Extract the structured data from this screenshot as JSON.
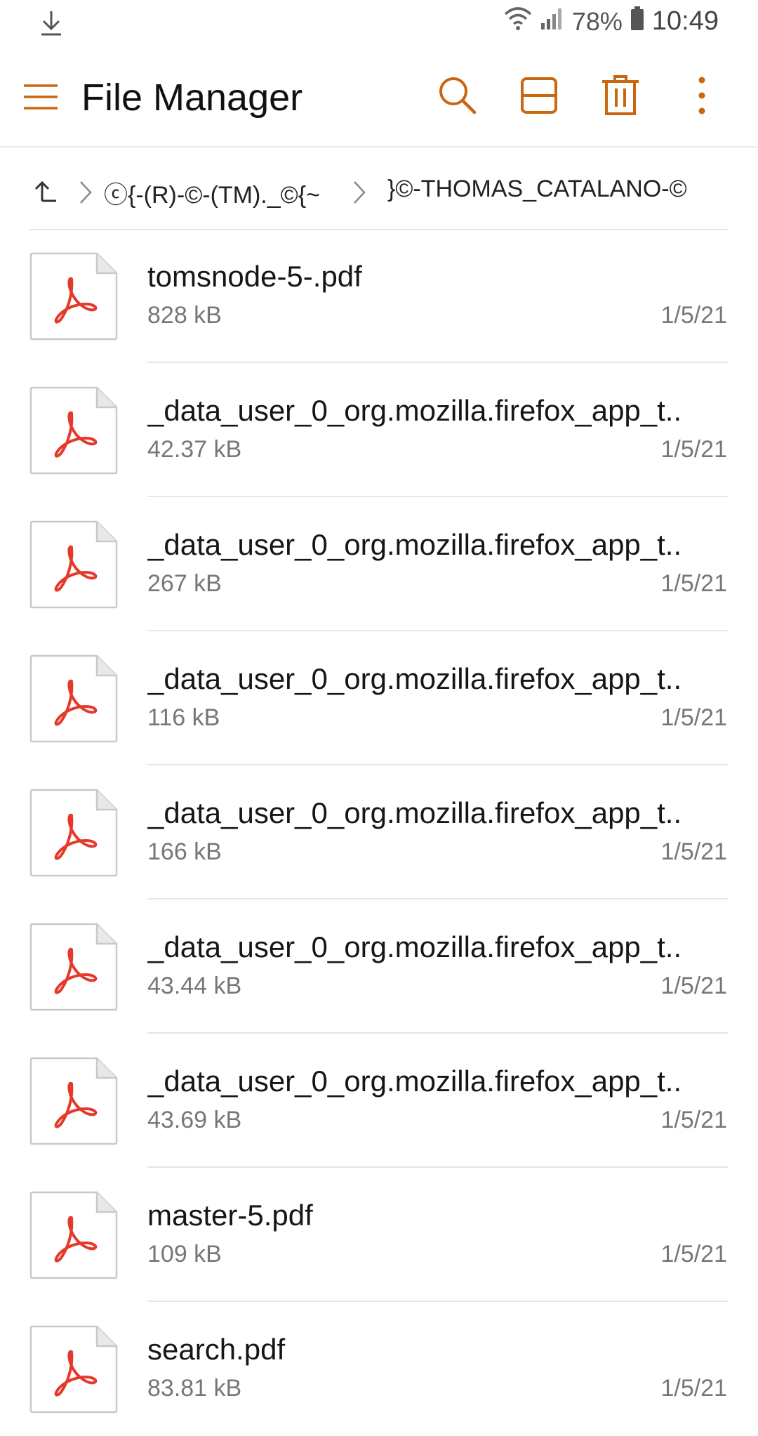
{
  "status_bar": {
    "battery_percent": "78%",
    "time": "10:49",
    "icons": [
      "download-icon",
      "wifi-icon",
      "signal-icon",
      "battery-icon"
    ]
  },
  "app_bar": {
    "title": "File Manager",
    "accent_color": "#c8670f",
    "actions": [
      "search-icon",
      "view-toggle-icon",
      "trash-icon",
      "more-vert-icon"
    ]
  },
  "breadcrumb": {
    "segments": [
      "ⓒ{-(R)-©-(TM)._©{~",
      "}©-THOMAS_CATALANO-©"
    ]
  },
  "files": [
    {
      "name": "tomsnode-5-.pdf",
      "size": "828 kB",
      "date": "1/5/21"
    },
    {
      "name": "_data_user_0_org.mozilla.firefox_app_t..",
      "size": "42.37 kB",
      "date": "1/5/21"
    },
    {
      "name": "_data_user_0_org.mozilla.firefox_app_t..",
      "size": "267 kB",
      "date": "1/5/21"
    },
    {
      "name": "_data_user_0_org.mozilla.firefox_app_t..",
      "size": "116 kB",
      "date": "1/5/21"
    },
    {
      "name": "_data_user_0_org.mozilla.firefox_app_t..",
      "size": "166 kB",
      "date": "1/5/21"
    },
    {
      "name": "_data_user_0_org.mozilla.firefox_app_t..",
      "size": "43.44 kB",
      "date": "1/5/21"
    },
    {
      "name": "_data_user_0_org.mozilla.firefox_app_t..",
      "size": "43.69 kB",
      "date": "1/5/21"
    },
    {
      "name": "master-5.pdf",
      "size": "109 kB",
      "date": "1/5/21"
    },
    {
      "name": "search.pdf",
      "size": "83.81 kB",
      "date": "1/5/21"
    }
  ]
}
